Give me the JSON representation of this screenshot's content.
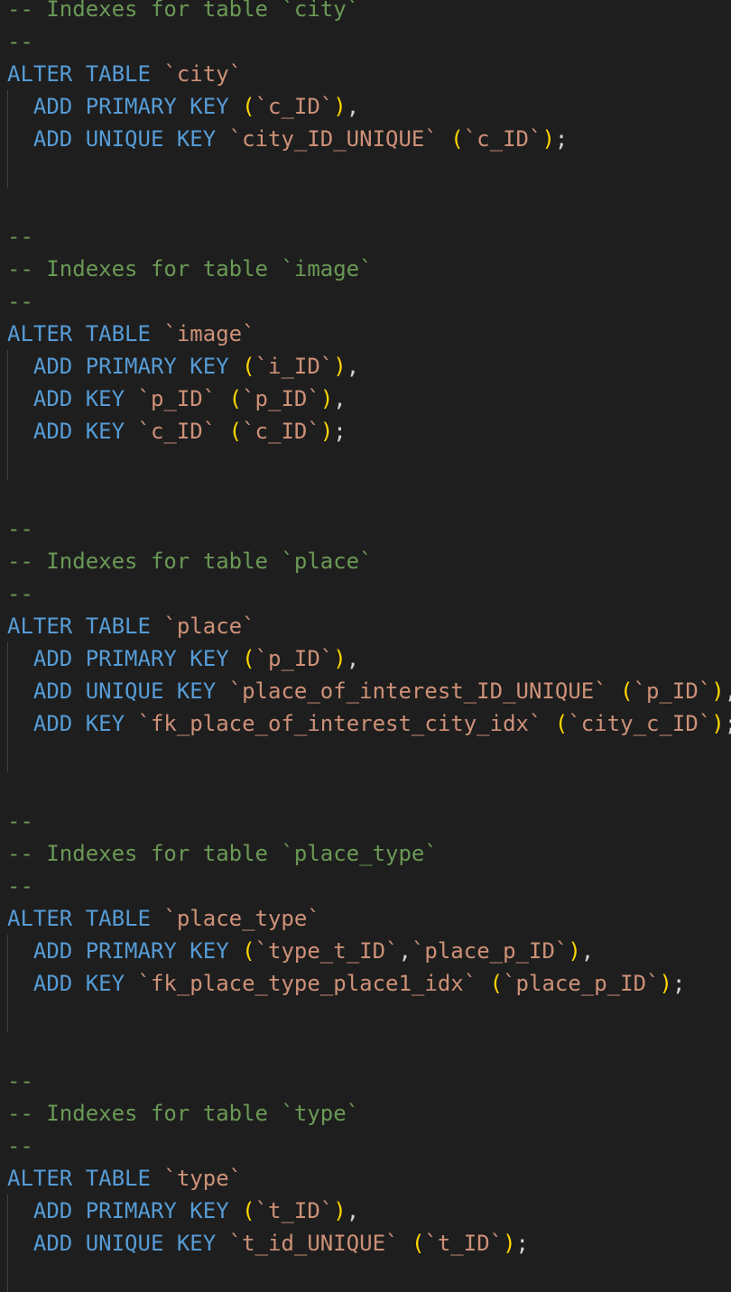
{
  "editor": {
    "language": "SQL",
    "theme_colors": {
      "background": "#1e1e1e",
      "comment": "#6a9955",
      "keyword": "#569cd6",
      "identifier": "#ce9178",
      "bracket": "#ffd700",
      "punctuation": "#d4d4d4",
      "indent_guide": "#404040"
    },
    "lines": [
      {
        "guide": false,
        "tokens": [
          {
            "t": "comment",
            "v": "-- Indexes for table `city`"
          }
        ]
      },
      {
        "guide": false,
        "tokens": [
          {
            "t": "comment",
            "v": "--"
          }
        ]
      },
      {
        "guide": false,
        "tokens": [
          {
            "t": "keyword",
            "v": "ALTER TABLE "
          },
          {
            "t": "ident",
            "v": "`city`"
          }
        ]
      },
      {
        "guide": true,
        "tokens": [
          {
            "t": "keyword",
            "v": "  ADD PRIMARY KEY "
          },
          {
            "t": "bracket",
            "v": "("
          },
          {
            "t": "ident",
            "v": "`c_ID`"
          },
          {
            "t": "bracket",
            "v": ")"
          },
          {
            "t": "punct",
            "v": ","
          }
        ]
      },
      {
        "guide": true,
        "tokens": [
          {
            "t": "keyword",
            "v": "  ADD UNIQUE KEY "
          },
          {
            "t": "ident",
            "v": "`city_ID_UNIQUE` "
          },
          {
            "t": "bracket",
            "v": "("
          },
          {
            "t": "ident",
            "v": "`c_ID`"
          },
          {
            "t": "bracket",
            "v": ")"
          },
          {
            "t": "punct",
            "v": ";"
          }
        ]
      },
      {
        "guide": true,
        "tokens": []
      },
      {
        "guide": false,
        "tokens": []
      },
      {
        "guide": false,
        "tokens": [
          {
            "t": "comment",
            "v": "--"
          }
        ]
      },
      {
        "guide": false,
        "tokens": [
          {
            "t": "comment",
            "v": "-- Indexes for table `image`"
          }
        ]
      },
      {
        "guide": false,
        "tokens": [
          {
            "t": "comment",
            "v": "--"
          }
        ]
      },
      {
        "guide": false,
        "tokens": [
          {
            "t": "keyword",
            "v": "ALTER TABLE "
          },
          {
            "t": "ident",
            "v": "`image`"
          }
        ]
      },
      {
        "guide": true,
        "tokens": [
          {
            "t": "keyword",
            "v": "  ADD PRIMARY KEY "
          },
          {
            "t": "bracket",
            "v": "("
          },
          {
            "t": "ident",
            "v": "`i_ID`"
          },
          {
            "t": "bracket",
            "v": ")"
          },
          {
            "t": "punct",
            "v": ","
          }
        ]
      },
      {
        "guide": true,
        "tokens": [
          {
            "t": "keyword",
            "v": "  ADD KEY "
          },
          {
            "t": "ident",
            "v": "`p_ID` "
          },
          {
            "t": "bracket",
            "v": "("
          },
          {
            "t": "ident",
            "v": "`p_ID`"
          },
          {
            "t": "bracket",
            "v": ")"
          },
          {
            "t": "punct",
            "v": ","
          }
        ]
      },
      {
        "guide": true,
        "tokens": [
          {
            "t": "keyword",
            "v": "  ADD KEY "
          },
          {
            "t": "ident",
            "v": "`c_ID` "
          },
          {
            "t": "bracket",
            "v": "("
          },
          {
            "t": "ident",
            "v": "`c_ID`"
          },
          {
            "t": "bracket",
            "v": ")"
          },
          {
            "t": "punct",
            "v": ";"
          }
        ]
      },
      {
        "guide": true,
        "tokens": []
      },
      {
        "guide": false,
        "tokens": []
      },
      {
        "guide": false,
        "tokens": [
          {
            "t": "comment",
            "v": "--"
          }
        ]
      },
      {
        "guide": false,
        "tokens": [
          {
            "t": "comment",
            "v": "-- Indexes for table `place`"
          }
        ]
      },
      {
        "guide": false,
        "tokens": [
          {
            "t": "comment",
            "v": "--"
          }
        ]
      },
      {
        "guide": false,
        "tokens": [
          {
            "t": "keyword",
            "v": "ALTER TABLE "
          },
          {
            "t": "ident",
            "v": "`place`"
          }
        ]
      },
      {
        "guide": true,
        "tokens": [
          {
            "t": "keyword",
            "v": "  ADD PRIMARY KEY "
          },
          {
            "t": "bracket",
            "v": "("
          },
          {
            "t": "ident",
            "v": "`p_ID`"
          },
          {
            "t": "bracket",
            "v": ")"
          },
          {
            "t": "punct",
            "v": ","
          }
        ]
      },
      {
        "guide": true,
        "tokens": [
          {
            "t": "keyword",
            "v": "  ADD UNIQUE KEY "
          },
          {
            "t": "ident",
            "v": "`place_of_interest_ID_UNIQUE` "
          },
          {
            "t": "bracket",
            "v": "("
          },
          {
            "t": "ident",
            "v": "`p_ID`"
          },
          {
            "t": "bracket",
            "v": ")"
          },
          {
            "t": "punct",
            "v": ","
          }
        ]
      },
      {
        "guide": true,
        "tokens": [
          {
            "t": "keyword",
            "v": "  ADD KEY "
          },
          {
            "t": "ident",
            "v": "`fk_place_of_interest_city_idx` "
          },
          {
            "t": "bracket",
            "v": "("
          },
          {
            "t": "ident",
            "v": "`city_c_ID`"
          },
          {
            "t": "bracket",
            "v": ")"
          },
          {
            "t": "punct",
            "v": ";"
          }
        ]
      },
      {
        "guide": true,
        "tokens": []
      },
      {
        "guide": false,
        "tokens": []
      },
      {
        "guide": false,
        "tokens": [
          {
            "t": "comment",
            "v": "--"
          }
        ]
      },
      {
        "guide": false,
        "tokens": [
          {
            "t": "comment",
            "v": "-- Indexes for table `place_type`"
          }
        ]
      },
      {
        "guide": false,
        "tokens": [
          {
            "t": "comment",
            "v": "--"
          }
        ]
      },
      {
        "guide": false,
        "tokens": [
          {
            "t": "keyword",
            "v": "ALTER TABLE "
          },
          {
            "t": "ident",
            "v": "`place_type`"
          }
        ]
      },
      {
        "guide": true,
        "tokens": [
          {
            "t": "keyword",
            "v": "  ADD PRIMARY KEY "
          },
          {
            "t": "bracket",
            "v": "("
          },
          {
            "t": "ident",
            "v": "`type_t_ID`"
          },
          {
            "t": "punct",
            "v": ","
          },
          {
            "t": "ident",
            "v": "`place_p_ID`"
          },
          {
            "t": "bracket",
            "v": ")"
          },
          {
            "t": "punct",
            "v": ","
          }
        ]
      },
      {
        "guide": true,
        "tokens": [
          {
            "t": "keyword",
            "v": "  ADD KEY "
          },
          {
            "t": "ident",
            "v": "`fk_place_type_place1_idx` "
          },
          {
            "t": "bracket",
            "v": "("
          },
          {
            "t": "ident",
            "v": "`place_p_ID`"
          },
          {
            "t": "bracket",
            "v": ")"
          },
          {
            "t": "punct",
            "v": ";"
          }
        ]
      },
      {
        "guide": true,
        "tokens": []
      },
      {
        "guide": false,
        "tokens": []
      },
      {
        "guide": false,
        "tokens": [
          {
            "t": "comment",
            "v": "--"
          }
        ]
      },
      {
        "guide": false,
        "tokens": [
          {
            "t": "comment",
            "v": "-- Indexes for table `type`"
          }
        ]
      },
      {
        "guide": false,
        "tokens": [
          {
            "t": "comment",
            "v": "--"
          }
        ]
      },
      {
        "guide": false,
        "tokens": [
          {
            "t": "keyword",
            "v": "ALTER TABLE "
          },
          {
            "t": "ident",
            "v": "`type`"
          }
        ]
      },
      {
        "guide": true,
        "tokens": [
          {
            "t": "keyword",
            "v": "  ADD PRIMARY KEY "
          },
          {
            "t": "bracket",
            "v": "("
          },
          {
            "t": "ident",
            "v": "`t_ID`"
          },
          {
            "t": "bracket",
            "v": ")"
          },
          {
            "t": "punct",
            "v": ","
          }
        ]
      },
      {
        "guide": true,
        "tokens": [
          {
            "t": "keyword",
            "v": "  ADD UNIQUE KEY "
          },
          {
            "t": "ident",
            "v": "`t_id_UNIQUE` "
          },
          {
            "t": "bracket",
            "v": "("
          },
          {
            "t": "ident",
            "v": "`t_ID`"
          },
          {
            "t": "bracket",
            "v": ")"
          },
          {
            "t": "punct",
            "v": ";"
          }
        ]
      },
      {
        "guide": true,
        "tokens": []
      }
    ]
  }
}
